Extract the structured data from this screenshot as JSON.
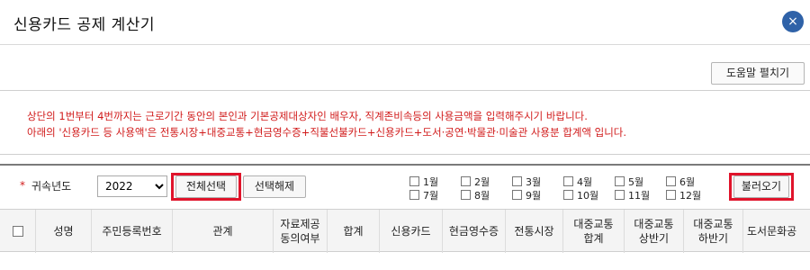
{
  "window": {
    "title": "신용카드 공제 계산기",
    "close_icon": "×"
  },
  "toolbar": {
    "help_label": "도움말 펼치기"
  },
  "notice": {
    "line1": "상단의 1번부터 4번까지는 근로기간 동안의 본인과 기본공제대상자인 배우자, 직계존비속등의 사용금액을 입력해주시기 바랍니다.",
    "line2": "아래의 '신용카드 등 사용액'은 전통시장+대중교통+현금영수증+직불선불카드+신용카드+도서·공연·박물관·미술관 사용분 합계액 입니다."
  },
  "filter": {
    "required_mark": "*",
    "year_label": "귀속년도",
    "year_value": "2022",
    "select_all_label": "전체선택",
    "deselect_label": "선택해제",
    "load_label": "불러오기",
    "months": [
      "1월",
      "2월",
      "3월",
      "4월",
      "5월",
      "6월",
      "7월",
      "8월",
      "9월",
      "10월",
      "11월",
      "12월"
    ]
  },
  "table": {
    "headers": [
      "성명",
      "주민등록번호",
      "관계",
      "자료제공\n동의여부",
      "합계",
      "신용카드",
      "현금영수증",
      "전통시장",
      "대중교통\n합계",
      "대중교통\n상반기",
      "대중교통\n하반기",
      "도서문화공"
    ]
  },
  "colors": {
    "accent_blue": "#2f62a8",
    "notice_red": "#d11b1b",
    "highlight_red": "#e0142b"
  }
}
